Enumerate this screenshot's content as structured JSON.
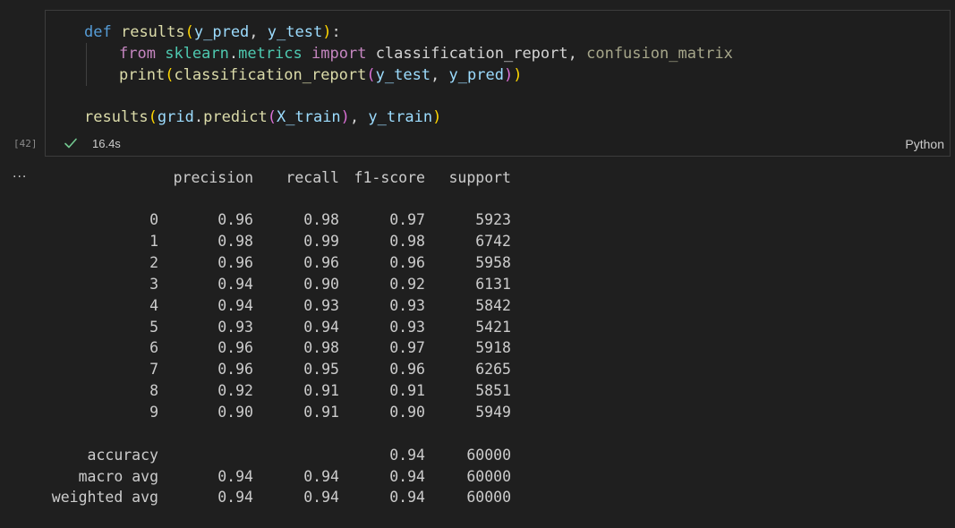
{
  "cell": {
    "execution_count": "[42]",
    "duration": "16.4s",
    "language": "Python",
    "status_icon": "check-icon",
    "code": {
      "line1": {
        "kw": "def",
        "fn": "results",
        "open": "(",
        "a1": "y_pred",
        "sep": ", ",
        "a2": "y_test",
        "close": ")",
        "colon": ":"
      },
      "line2": {
        "from": "from",
        "mod1": "sklearn",
        "dot": ".",
        "mod2": "metrics",
        "import": "import",
        "n1": "classification_report",
        "sep": ", ",
        "n2": "confusion_matrix"
      },
      "line3": {
        "fn": "print",
        "o1": "(",
        "fn2": "classification_report",
        "o2": "(",
        "a1": "y_test",
        "sep": ", ",
        "a2": "y_pred",
        "c2": ")",
        "c1": ")"
      },
      "line4": {
        "fn": "results",
        "o1": "(",
        "obj": "grid",
        "dot": ".",
        "m": "predict",
        "o2": "(",
        "a1": "X_train",
        "c2": ")",
        "sep": ", ",
        "a2": "y_train",
        "c1": ")"
      }
    }
  },
  "output": {
    "menu_icon": "ellipsis-icon",
    "headers": [
      "precision",
      "recall",
      "f1-score",
      "support"
    ],
    "rows": [
      {
        "label": "0",
        "precision": "0.96",
        "recall": "0.98",
        "f1": "0.97",
        "support": "5923"
      },
      {
        "label": "1",
        "precision": "0.98",
        "recall": "0.99",
        "f1": "0.98",
        "support": "6742"
      },
      {
        "label": "2",
        "precision": "0.96",
        "recall": "0.96",
        "f1": "0.96",
        "support": "5958"
      },
      {
        "label": "3",
        "precision": "0.94",
        "recall": "0.90",
        "f1": "0.92",
        "support": "6131"
      },
      {
        "label": "4",
        "precision": "0.94",
        "recall": "0.93",
        "f1": "0.93",
        "support": "5842"
      },
      {
        "label": "5",
        "precision": "0.93",
        "recall": "0.94",
        "f1": "0.93",
        "support": "5421"
      },
      {
        "label": "6",
        "precision": "0.96",
        "recall": "0.98",
        "f1": "0.97",
        "support": "5918"
      },
      {
        "label": "7",
        "precision": "0.96",
        "recall": "0.95",
        "f1": "0.96",
        "support": "6265"
      },
      {
        "label": "8",
        "precision": "0.92",
        "recall": "0.91",
        "f1": "0.91",
        "support": "5851"
      },
      {
        "label": "9",
        "precision": "0.90",
        "recall": "0.91",
        "f1": "0.90",
        "support": "5949"
      }
    ],
    "summary": [
      {
        "label": "accuracy",
        "precision": "",
        "recall": "",
        "f1": "0.94",
        "support": "60000"
      },
      {
        "label": "macro avg",
        "precision": "0.94",
        "recall": "0.94",
        "f1": "0.94",
        "support": "60000"
      },
      {
        "label": "weighted avg",
        "precision": "0.94",
        "recall": "0.94",
        "f1": "0.94",
        "support": "60000"
      }
    ]
  },
  "colors": {
    "background": "#1f1f1f",
    "cell_border": "#3c3c3c",
    "success_check": "#73c991",
    "keyword": "#569cd6",
    "control_keyword": "#c586c0",
    "function": "#dcdcaa",
    "variable": "#9cdcfe",
    "module": "#4ec9b0"
  }
}
